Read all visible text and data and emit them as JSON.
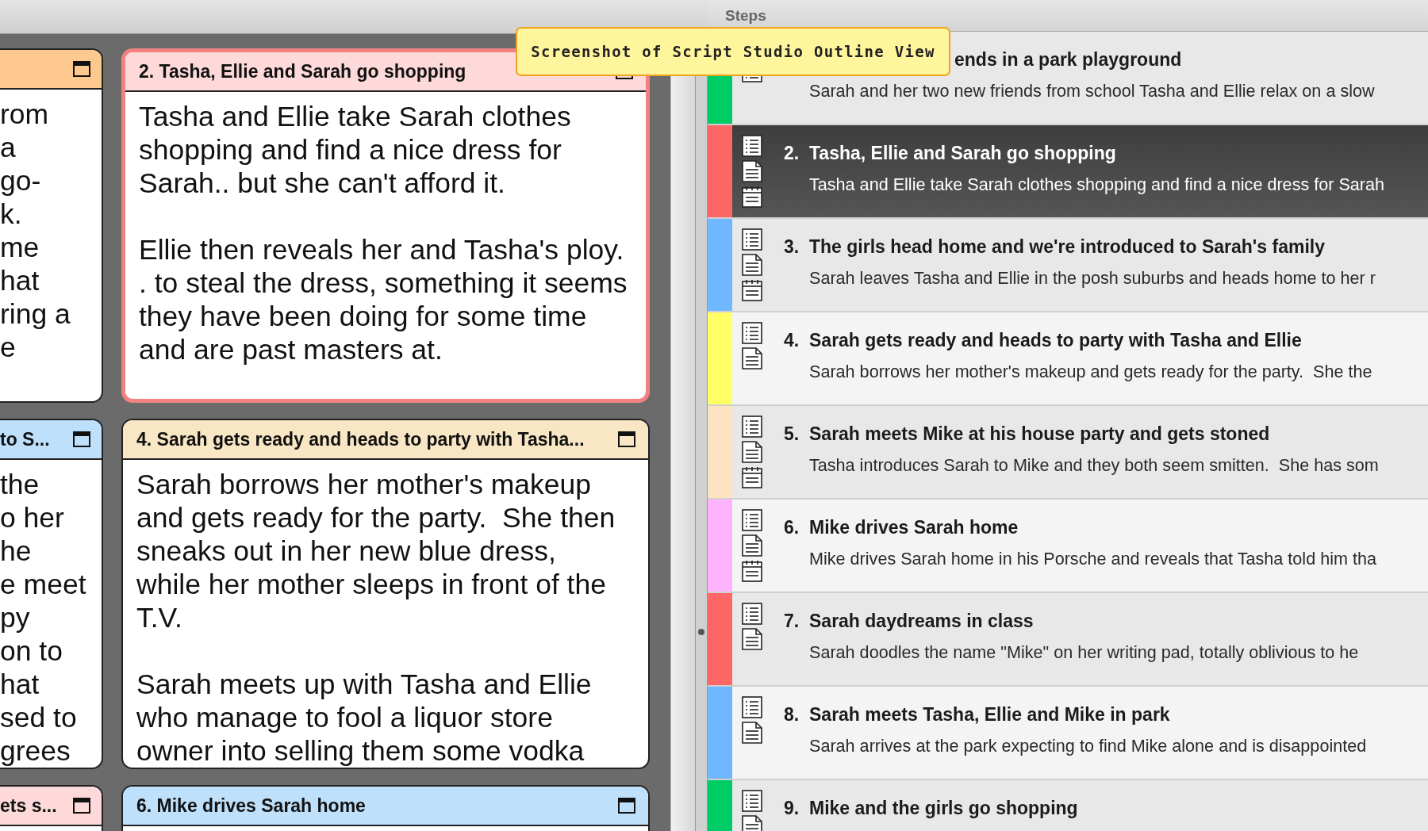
{
  "caption": "Screenshot of Script Studio Outline View",
  "board": {
    "rows": [
      [
        {
          "color": "#fdc98f",
          "selected": false,
          "paragraphs": [
            [
              "rom",
              "a",
              "go-",
              "k.",
              "me",
              "hat",
              "ring a",
              "e"
            ]
          ]
        },
        {
          "title": "2. Tasha, Ellie and Sarah go shopping",
          "color": "#fdd9d9",
          "selected": true,
          "paragraphs": [
            [
              "Tasha and Ellie take Sarah clothes",
              "shopping and find a nice dress for",
              "Sarah.. but she can't afford it."
            ],
            [
              "Ellie then reveals her and Tasha's ploy.",
              ". to steal the dress, something it seems",
              "they have been doing for some time",
              "and are past masters at."
            ]
          ]
        }
      ],
      [
        {
          "title": "to S...",
          "color": "#bfe0fb",
          "selected": false,
          "paragraphs": [
            [
              "the",
              "o her",
              "he",
              "e meet",
              "py",
              "on to",
              "hat",
              "sed to",
              "grees"
            ]
          ]
        },
        {
          "title": "4. Sarah gets ready and heads to party with Tasha...",
          "color": "#f8e6c4",
          "selected": false,
          "paragraphs": [
            [
              "Sarah borrows her mother's makeup",
              "and gets ready for the party.  She then",
              "sneaks out in her new blue dress,",
              "while her mother sleeps in front of the",
              "T.V."
            ],
            [
              "Sarah meets up with Tasha and Ellie",
              "who manage to fool a liquor store",
              "owner into selling them some vodka"
            ]
          ]
        }
      ],
      [
        {
          "title": "ets s...",
          "color": "#fdd9d9",
          "selected": false
        },
        {
          "title": "6. Mike drives Sarah home",
          "color": "#bfe0fb",
          "selected": false
        }
      ]
    ]
  },
  "steps": {
    "title": "Steps",
    "rows": [
      {
        "title": "ends in a park playground",
        "description": "Sarah and her two new friends from school Tasha and Ellie relax on a slow",
        "color": "#00cc66",
        "selected": false,
        "icons": [
          {
            "kind": "outline"
          }
        ]
      },
      {
        "number": "2.",
        "title": "Tasha, Ellie and Sarah go shopping",
        "description": "Tasha and Ellie take Sarah clothes shopping and find a nice dress for Sarah",
        "color": "#ff6666",
        "selected": true,
        "icons": [
          {
            "kind": "outline"
          },
          {
            "kind": "text"
          },
          {
            "kind": "calendar"
          }
        ]
      },
      {
        "number": "3.",
        "title": "The girls head home and we're introduced to Sarah's family",
        "description": "Sarah leaves Tasha and Ellie in the posh suburbs and heads home to her r",
        "color": "#6fb7ff",
        "selected": false,
        "icons": [
          {
            "kind": "outline"
          },
          {
            "kind": "text"
          },
          {
            "kind": "calendar"
          }
        ]
      },
      {
        "number": "4.",
        "title": "Sarah gets ready and heads to party with Tasha and Ellie",
        "description": "Sarah borrows her mother's makeup and gets ready for the party.  She the",
        "color": "#ffff66",
        "selected": false,
        "icons": [
          {
            "kind": "outline"
          },
          {
            "kind": "text"
          }
        ]
      },
      {
        "number": "5.",
        "title": "Sarah meets Mike at his house party and gets stoned",
        "description": "Tasha introduces Sarah to Mike and they both seem smitten.  She has som",
        "color": "#fde3c2",
        "selected": false,
        "icons": [
          {
            "kind": "outline"
          },
          {
            "kind": "text"
          },
          {
            "kind": "calendar"
          }
        ]
      },
      {
        "number": "6.",
        "title": "Mike drives Sarah home",
        "description": "Mike drives Sarah home in his Porsche and reveals that Tasha told him tha",
        "color": "#ffb3ff",
        "selected": false,
        "icons": [
          {
            "kind": "outline"
          },
          {
            "kind": "text"
          },
          {
            "kind": "calendar"
          }
        ]
      },
      {
        "number": "7.",
        "title": "Sarah daydreams in class",
        "description": "Sarah doodles the name \"Mike\" on her writing pad, totally oblivious to he",
        "color": "#ff6666",
        "selected": false,
        "icons": [
          {
            "kind": "outline"
          },
          {
            "kind": "text"
          }
        ]
      },
      {
        "number": "8.",
        "title": "Sarah meets Tasha, Ellie and Mike in park",
        "description": "Sarah arrives at the park expecting to find Mike alone and is disappointed",
        "color": "#6fb7ff",
        "selected": false,
        "icons": [
          {
            "kind": "outline"
          },
          {
            "kind": "text"
          }
        ]
      },
      {
        "number": "9.",
        "title": "Mike and the girls go shopping",
        "color": "#00cc66",
        "selected": false,
        "icons": [
          {
            "kind": "outline"
          },
          {
            "kind": "text"
          }
        ]
      }
    ]
  }
}
